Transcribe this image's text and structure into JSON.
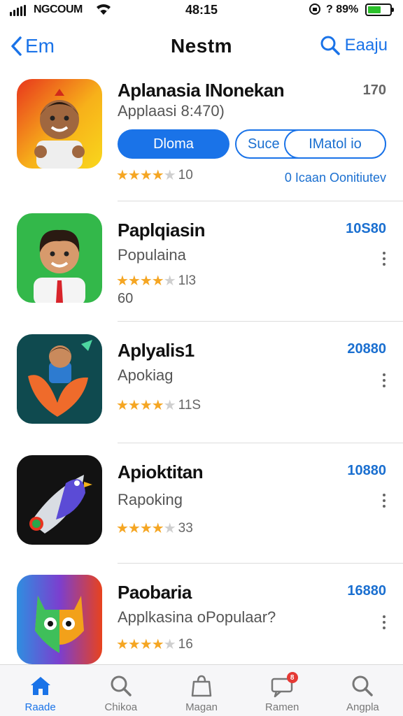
{
  "status": {
    "carrier": "NGCOUM",
    "time": "48:15",
    "battery": "? 89%"
  },
  "nav": {
    "back_label": "Em",
    "title": "Nestm",
    "right_label": "Eaaju"
  },
  "apps": [
    {
      "name": "Aplanasia INonekan",
      "subtitle": "Applaasi 8:470)",
      "price": "170",
      "rating_count": "10",
      "primary_button": "Dloma",
      "secondary_button_1": "Suce",
      "secondary_button_2": "IMatol io",
      "note": "0 Icaan Oonitiutev"
    },
    {
      "name": "Paplqiasin",
      "subtitle": "Populaina",
      "price": "10S80",
      "rating_count": "1l3",
      "extra": "60"
    },
    {
      "name": "Aplyalis1",
      "subtitle": "Apokiag",
      "price": "20880",
      "rating_count": "11S"
    },
    {
      "name": "Apioktitan",
      "subtitle": "Rapoking",
      "price": "10880",
      "rating_count": "33"
    },
    {
      "name": "Paobaria",
      "subtitle": "Applkasina oPopulaar?",
      "price": "16880",
      "rating_count": "16"
    }
  ],
  "tabs": [
    {
      "label": "Raade",
      "icon": "home-icon",
      "active": true
    },
    {
      "label": "Chikoa",
      "icon": "search-icon"
    },
    {
      "label": "Magan",
      "icon": "bag-icon"
    },
    {
      "label": "Ramen",
      "icon": "chat-icon",
      "badge": "8"
    },
    {
      "label": "Angpla",
      "icon": "search-icon"
    }
  ],
  "colors": {
    "accent": "#1a73e8",
    "star": "#f5a623",
    "battery": "#2bc12b",
    "badge": "#e53935"
  }
}
